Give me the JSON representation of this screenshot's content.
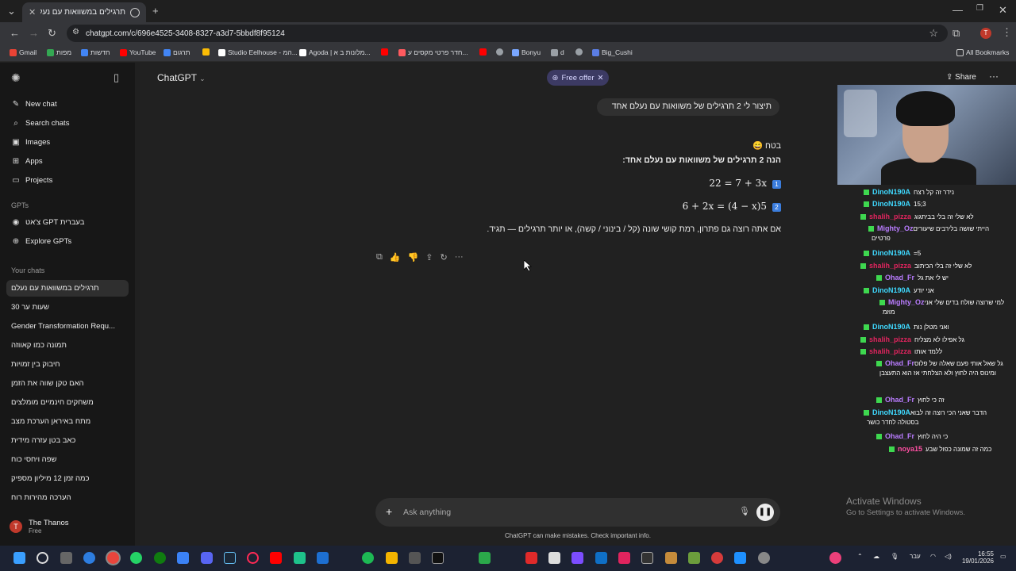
{
  "browser": {
    "tab_title": "תרגילים במשוואות עם נעלם",
    "url": "chatgpt.com/c/696e4525-3408-8327-a3d7-5bbdf8f95124",
    "bookmarks": [
      "Gmail",
      "מפות",
      "חדשות",
      "YouTube",
      "תרגום",
      "Studio Eelhouse - המ...",
      "Agoda | מלונות ב א...",
      "חדר פרטי מקסים ע...",
      "Bonyu",
      "d",
      "Big_Cushi"
    ],
    "all_bookmarks": "All Bookmarks",
    "profile_initial": "T"
  },
  "sidebar": {
    "top_items": [
      {
        "label": "New chat",
        "icon": "edit-icon"
      },
      {
        "label": "Search chats",
        "icon": "search-icon"
      },
      {
        "label": "Images",
        "icon": "image-icon"
      },
      {
        "label": "Apps",
        "icon": "apps-icon"
      },
      {
        "label": "Projects",
        "icon": "folder-icon"
      }
    ],
    "gpts_label": "GPTs",
    "gpts": [
      "צ'אט GPT בעברית",
      "Explore GPTs"
    ],
    "your_chats_label": "Your chats",
    "chats": [
      "תרגילים במשוואות עם נעלם",
      "30 שעות ער",
      "Gender Transformation Requ...",
      "תמונה כמו קאווזה",
      "חיבוק בין זמויות",
      "האם טקן שווה את הזמן",
      "משחקים חינמיים מומלצים",
      "מתח באיראן הערכת מצב",
      "כאב בטן עזרה מידית",
      "שפה ויחסי כוח",
      "כמה זמן 12 מיליון מספיק",
      "הערכה מהירות רוח"
    ],
    "user_name": "The Thanos",
    "user_plan": "Free",
    "user_initial": "T"
  },
  "header": {
    "model": "ChatGPT",
    "offer": "Free offer",
    "share": "Share"
  },
  "conversation": {
    "user_message": "תיצור לי 2 תרגילים של משוואות עם נעלם אחד",
    "answer_intro": "בטח 😄",
    "answer_line2": "הנה 2 תרגילים של משוואות עם נעלם אחד:",
    "eq1": "22 = 7 + 3x",
    "eq2": "6 + 2x = (4 − x)5",
    "answer_outro": "אם אתה רוצה גם פתרון, רמת קושי שונה (קל / בינוני / קשה), או יותר תרגילים — תגיד."
  },
  "composer": {
    "placeholder": "Ask anything",
    "disclaimer": "ChatGPT can make mistakes. Check important info."
  },
  "stream_chat": [
    {
      "name": "DinoN190A",
      "color": "#3fd9ff",
      "text": "נידר זה קל רצח"
    },
    {
      "name": "DinoN190A",
      "color": "#3fd9ff",
      "text": "15;3"
    },
    {
      "name": "shalih_pizza",
      "color": "#e0245e",
      "text": "לא שלי זה בלי בביתגוג"
    },
    {
      "name": "Mighty_Oz",
      "color": "#b97cff",
      "text": "הייתי שושה בלירבים שיעורים פרטיים"
    },
    {
      "name": "DinoN190A",
      "color": "#3fd9ff",
      "text": "=5"
    },
    {
      "name": "shalih_pizza",
      "color": "#e0245e",
      "text": "לא שלי זה בלי הכיתוב"
    },
    {
      "name": "Ohad_Fr",
      "color": "#b97cff",
      "text": "יש לי את גל"
    },
    {
      "name": "DinoN190A",
      "color": "#3fd9ff",
      "text": "אני יודע"
    },
    {
      "name": "Mighty_Oz",
      "color": "#b97cff",
      "text": "למי שרוצה שולח בדים שלי אני מוזמ"
    },
    {
      "name": "DinoN190A",
      "color": "#3fd9ff",
      "text": "ואני מטלן נות"
    },
    {
      "name": "shalih_pizza",
      "color": "#e0245e",
      "text": "גל אפילו לא מצליח"
    },
    {
      "name": "shalih_pizza",
      "color": "#e0245e",
      "text": "ללמד אותו"
    },
    {
      "name": "Ohad_Fr",
      "color": "#b97cff",
      "text": "גל שאל אותי פעם שאלה של פלוס ומינוס היה לחוץ ולא הצלחתי אז הוא התעצבן"
    },
    {
      "name": "Ohad_Fr",
      "color": "#b97cff",
      "text": "זה כי לחוץ"
    },
    {
      "name": "DinoN190A",
      "color": "#3fd9ff",
      "text": "הדבר שאני הכי רוצה זה לבוא בסטולה לחדר כושר"
    },
    {
      "name": "Ohad_Fr",
      "color": "#b97cff",
      "text": "כי היה לחוץ"
    },
    {
      "name": "noya15",
      "color": "#ff4fa3",
      "text": "כמה זה שמונה כפול שבע"
    }
  ],
  "windows": {
    "activate_title": "Activate Windows",
    "activate_sub": "Go to Settings to activate Windows.",
    "time": "16:55",
    "date": "19/01/2026",
    "lang": "עבר"
  }
}
